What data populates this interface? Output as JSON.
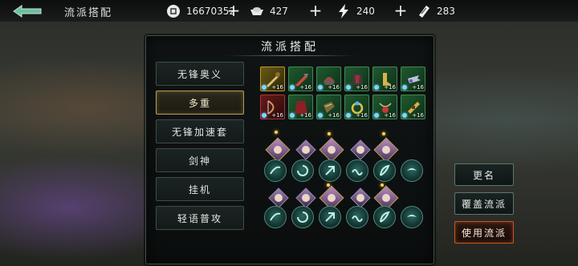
{
  "header": {
    "title": "流派搭配",
    "back_icon": "back-arrow-icon",
    "resources": [
      {
        "icon": "coin-icon",
        "value": "16670352"
      },
      {
        "icon": "ingot-icon",
        "value": "427"
      },
      {
        "icon": "lightning-icon",
        "value": "240"
      },
      {
        "icon": "ticket-icon",
        "value": "283"
      }
    ]
  },
  "panel": {
    "title": "流派搭配",
    "builds": [
      {
        "label": "无锋奥义",
        "selected": false
      },
      {
        "label": "多重",
        "selected": true
      },
      {
        "label": "无锋加速套",
        "selected": false
      },
      {
        "label": "剑神",
        "selected": false
      },
      {
        "label": "挂机",
        "selected": false
      },
      {
        "label": "轻语普攻",
        "selected": false
      }
    ],
    "equipment": {
      "row1": [
        {
          "level": "+16",
          "rarity": "gold"
        },
        {
          "level": "+16",
          "rarity": "green"
        },
        {
          "level": "+16",
          "rarity": "green"
        },
        {
          "level": "+16",
          "rarity": "green"
        },
        {
          "level": "+16",
          "rarity": "green"
        },
        {
          "level": "+16",
          "rarity": "green"
        }
      ],
      "row2": [
        {
          "level": "+16",
          "rarity": "red"
        },
        {
          "level": "+16",
          "rarity": "green"
        },
        {
          "level": "+16",
          "rarity": "green"
        },
        {
          "level": "+16",
          "rarity": "green"
        },
        {
          "level": "+16",
          "rarity": "green"
        },
        {
          "level": "+16",
          "rarity": "green"
        }
      ]
    }
  },
  "side_buttons": {
    "rename": "更名",
    "overwrite": "覆盖流派",
    "use": "使用流派"
  },
  "colors": {
    "accent_gold": "#b59a55",
    "accent_orange": "#c2542a",
    "panel_border": "#3f514c"
  }
}
